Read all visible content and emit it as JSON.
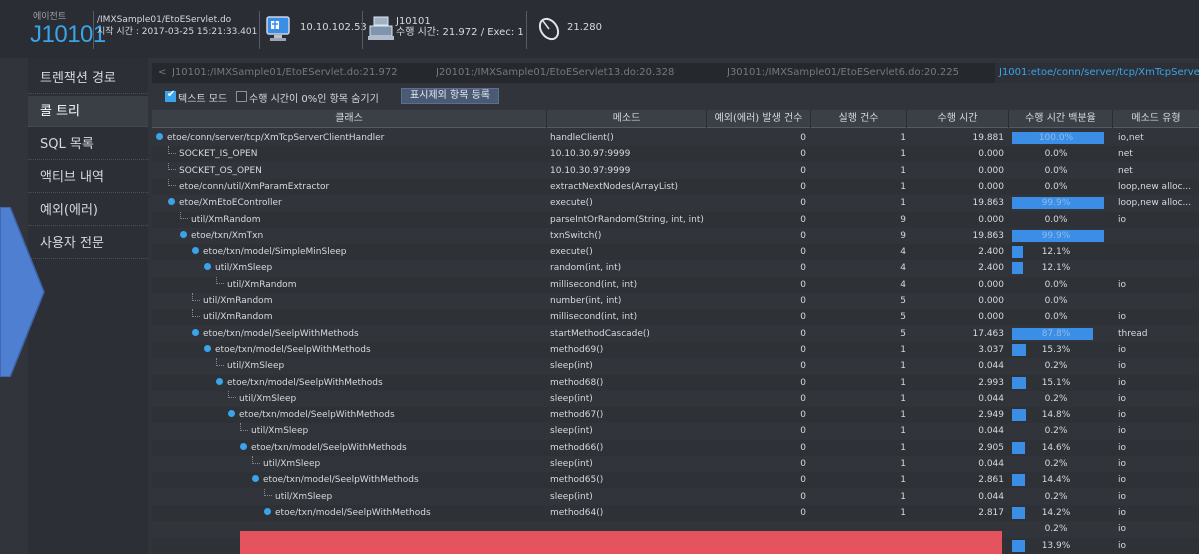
{
  "header": {
    "agent_label": "에이전트",
    "agent_id": "J10101",
    "path_line1": "/IMXSample01/EtoEServlet.do",
    "path_line2": "시작 시간 : 2017-03-25 15:21:33.401",
    "ip": "10.10.102.53",
    "txn_line1": "J10101",
    "txn_line2": "수행 시간: 21.972 / Exec: 1",
    "count": "21.280"
  },
  "sidebar": {
    "items": [
      {
        "label": "트렌잭션 경로"
      },
      {
        "label": "콜 트리"
      },
      {
        "label": "SQL 목록"
      },
      {
        "label": "액티브 내역"
      },
      {
        "label": "예외(에러)"
      },
      {
        "label": "사용자 전문"
      }
    ]
  },
  "tabs": {
    "back_arrow": "<",
    "items": [
      {
        "label": "J10101:/IMXSample01/EtoEServlet.do:21.972"
      },
      {
        "label": "J20101:/IMXSample01/EtoEServlet13.do:20.328"
      },
      {
        "label": "J30101:/IMXSample01/EtoEServlet6.do:20.225"
      },
      {
        "label": "J1001:etoe/conn/server/tcp/XmTcpServe"
      }
    ]
  },
  "options": {
    "text_mode": "텍스트 모드",
    "hide_zero": "수행 시간이 0%인 항목 숨기기",
    "register_button": "표시제외 항목 등록"
  },
  "table": {
    "headers": [
      "클래스",
      "메소드",
      "예외(에러) 발생 건수",
      "실행 건수",
      "수행 시간",
      "수행 시간 백분율",
      "메소드 유형"
    ],
    "rows": [
      {
        "cls": "etoe/conn/server/tcp/XmTcpServerClientHandler",
        "method": "handleClient()",
        "err": "0",
        "cnt": "1",
        "time": "19.881",
        "pct": "100.0%",
        "pct_value": 100,
        "type": "io,net",
        "indent": 0,
        "node": true
      },
      {
        "cls": "SOCKET_IS_OPEN",
        "method": "10.10.30.97:9999",
        "err": "0",
        "cnt": "1",
        "time": "0.000",
        "pct": "0.0%",
        "pct_value": 0,
        "type": "net",
        "indent": 1,
        "node": false
      },
      {
        "cls": "SOCKET_OS_OPEN",
        "method": "10.10.30.97:9999",
        "err": "0",
        "cnt": "1",
        "time": "0.000",
        "pct": "0.0%",
        "pct_value": 0,
        "type": "net",
        "indent": 1,
        "node": false
      },
      {
        "cls": "etoe/conn/util/XmParamExtractor",
        "method": "extractNextNodes(ArrayList)",
        "err": "0",
        "cnt": "1",
        "time": "0.000",
        "pct": "0.0%",
        "pct_value": 0,
        "type": "loop,new alloc...",
        "indent": 1,
        "node": false
      },
      {
        "cls": "etoe/XmEtoEController",
        "method": "execute()",
        "err": "0",
        "cnt": "1",
        "time": "19.863",
        "pct": "99.9%",
        "pct_value": 99.9,
        "type": "loop,new alloc...",
        "indent": 1,
        "node": true
      },
      {
        "cls": "util/XmRandom",
        "method": "parseIntOrRandom(String, int, int)",
        "err": "0",
        "cnt": "9",
        "time": "0.000",
        "pct": "0.0%",
        "pct_value": 0,
        "type": "io",
        "indent": 2,
        "node": false
      },
      {
        "cls": "etoe/txn/XmTxn",
        "method": "txnSwitch()",
        "err": "0",
        "cnt": "9",
        "time": "19.863",
        "pct": "99.9%",
        "pct_value": 99.9,
        "type": "",
        "indent": 2,
        "node": true
      },
      {
        "cls": "etoe/txn/model/SimpleMinSleep",
        "method": "execute()",
        "err": "0",
        "cnt": "4",
        "time": "2.400",
        "pct": "12.1%",
        "pct_value": 12.1,
        "type": "",
        "indent": 3,
        "node": true
      },
      {
        "cls": "util/XmSleep",
        "method": "random(int, int)",
        "err": "0",
        "cnt": "4",
        "time": "2.400",
        "pct": "12.1%",
        "pct_value": 12.1,
        "type": "",
        "indent": 4,
        "node": true
      },
      {
        "cls": "util/XmRandom",
        "method": "millisecond(int, int)",
        "err": "0",
        "cnt": "4",
        "time": "0.000",
        "pct": "0.0%",
        "pct_value": 0,
        "type": "io",
        "indent": 5,
        "node": false
      },
      {
        "cls": "util/XmRandom",
        "method": "number(int, int)",
        "err": "0",
        "cnt": "5",
        "time": "0.000",
        "pct": "0.0%",
        "pct_value": 0,
        "type": "",
        "indent": 3,
        "node": false
      },
      {
        "cls": "util/XmRandom",
        "method": "millisecond(int, int)",
        "err": "0",
        "cnt": "5",
        "time": "0.000",
        "pct": "0.0%",
        "pct_value": 0,
        "type": "io",
        "indent": 3,
        "node": false
      },
      {
        "cls": "etoe/txn/model/SeelpWithMethods",
        "method": "startMethodCascade()",
        "err": "0",
        "cnt": "5",
        "time": "17.463",
        "pct": "87.8%",
        "pct_value": 87.8,
        "type": "thread",
        "indent": 3,
        "node": true
      },
      {
        "cls": "etoe/txn/model/SeelpWithMethods",
        "method": "method69()",
        "err": "0",
        "cnt": "1",
        "time": "3.037",
        "pct": "15.3%",
        "pct_value": 15.3,
        "type": "io",
        "indent": 4,
        "node": true
      },
      {
        "cls": "util/XmSleep",
        "method": "sleep(int)",
        "err": "0",
        "cnt": "1",
        "time": "0.044",
        "pct": "0.2%",
        "pct_value": 0.2,
        "type": "io",
        "indent": 5,
        "node": false
      },
      {
        "cls": "etoe/txn/model/SeelpWithMethods",
        "method": "method68()",
        "err": "0",
        "cnt": "1",
        "time": "2.993",
        "pct": "15.1%",
        "pct_value": 15.1,
        "type": "io",
        "indent": 5,
        "node": true
      },
      {
        "cls": "util/XmSleep",
        "method": "sleep(int)",
        "err": "0",
        "cnt": "1",
        "time": "0.044",
        "pct": "0.2%",
        "pct_value": 0.2,
        "type": "io",
        "indent": 6,
        "node": false
      },
      {
        "cls": "etoe/txn/model/SeelpWithMethods",
        "method": "method67()",
        "err": "0",
        "cnt": "1",
        "time": "2.949",
        "pct": "14.8%",
        "pct_value": 14.8,
        "type": "io",
        "indent": 6,
        "node": true
      },
      {
        "cls": "util/XmSleep",
        "method": "sleep(int)",
        "err": "0",
        "cnt": "1",
        "time": "0.044",
        "pct": "0.2%",
        "pct_value": 0.2,
        "type": "io",
        "indent": 7,
        "node": false
      },
      {
        "cls": "etoe/txn/model/SeelpWithMethods",
        "method": "method66()",
        "err": "0",
        "cnt": "1",
        "time": "2.905",
        "pct": "14.6%",
        "pct_value": 14.6,
        "type": "io",
        "indent": 7,
        "node": true
      },
      {
        "cls": "util/XmSleep",
        "method": "sleep(int)",
        "err": "0",
        "cnt": "1",
        "time": "0.044",
        "pct": "0.2%",
        "pct_value": 0.2,
        "type": "io",
        "indent": 8,
        "node": false
      },
      {
        "cls": "etoe/txn/model/SeelpWithMethods",
        "method": "method65()",
        "err": "0",
        "cnt": "1",
        "time": "2.861",
        "pct": "14.4%",
        "pct_value": 14.4,
        "type": "io",
        "indent": 8,
        "node": true
      },
      {
        "cls": "util/XmSleep",
        "method": "sleep(int)",
        "err": "0",
        "cnt": "1",
        "time": "0.044",
        "pct": "0.2%",
        "pct_value": 0.2,
        "type": "io",
        "indent": 9,
        "node": false
      },
      {
        "cls": "etoe/txn/model/SeelpWithMethods",
        "method": "method64()",
        "err": "0",
        "cnt": "1",
        "time": "2.817",
        "pct": "14.2%",
        "pct_value": 14.2,
        "type": "io",
        "indent": 9,
        "node": true
      },
      {
        "cls": "",
        "method": "",
        "err": "",
        "cnt": "",
        "time": "",
        "pct": "0.2%",
        "pct_value": 0.2,
        "type": "io",
        "indent": 10,
        "node": false
      },
      {
        "cls": "",
        "method": "",
        "err": "",
        "cnt": "",
        "time": "",
        "pct": "13.9%",
        "pct_value": 13.9,
        "type": "io",
        "indent": 10,
        "node": false
      }
    ]
  }
}
